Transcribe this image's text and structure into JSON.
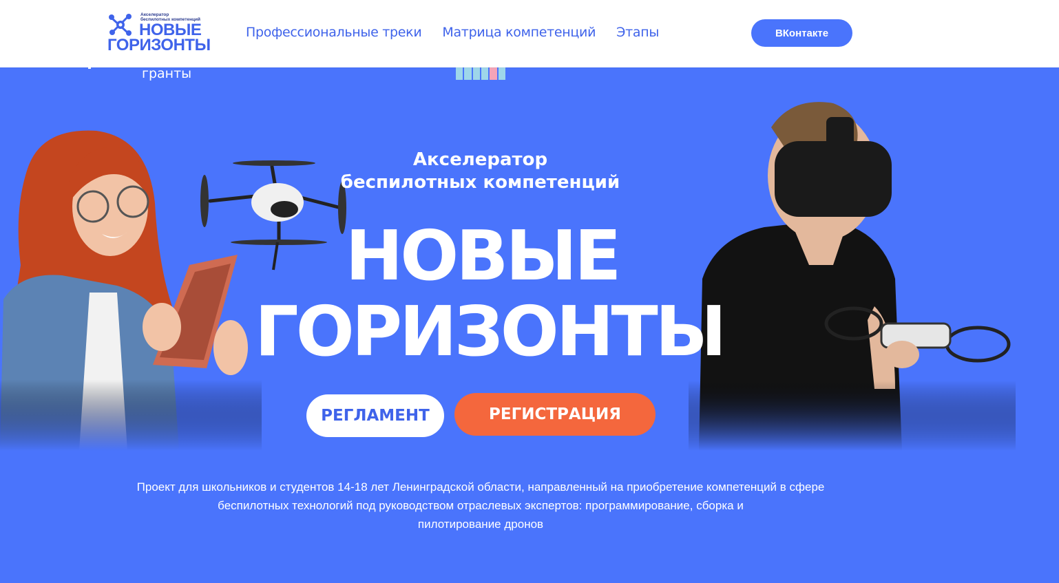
{
  "header": {
    "logo_small_text": "Акселератор\nбеспилотных компетенций",
    "logo_line1": "НОВЫЕ",
    "logo_line2": "ГОРИЗОНТЫ",
    "nav": [
      {
        "label": "Профессиональные треки"
      },
      {
        "label": "Матрица компетенций"
      },
      {
        "label": "Этапы"
      }
    ],
    "vk_button": "ВКонтакте"
  },
  "behind_header": {
    "grants_text": "гранты"
  },
  "hero": {
    "subtitle_line1": "Акселератор",
    "subtitle_line2": "беспилотных компетенций",
    "title_line1": "НОВЫЕ",
    "title_line2": "ГОРИЗОНТЫ",
    "rules_button": "РЕГЛАМЕНТ",
    "register_button": "РЕГИСТРАЦИЯ"
  },
  "description": {
    "line1": "Проект для школьников и студентов 14-18 лет Ленинградской области, направленный на приобретение компетенций в сфере",
    "line2": "беспилотных технологий под руководством отраслевых экспертов: программирование, сборка и",
    "line3": "пилотирование дронов"
  },
  "colors": {
    "background": "#4a74fc",
    "accent_blue": "#3f63ea",
    "orange": "#f4673d",
    "white": "#ffffff"
  }
}
